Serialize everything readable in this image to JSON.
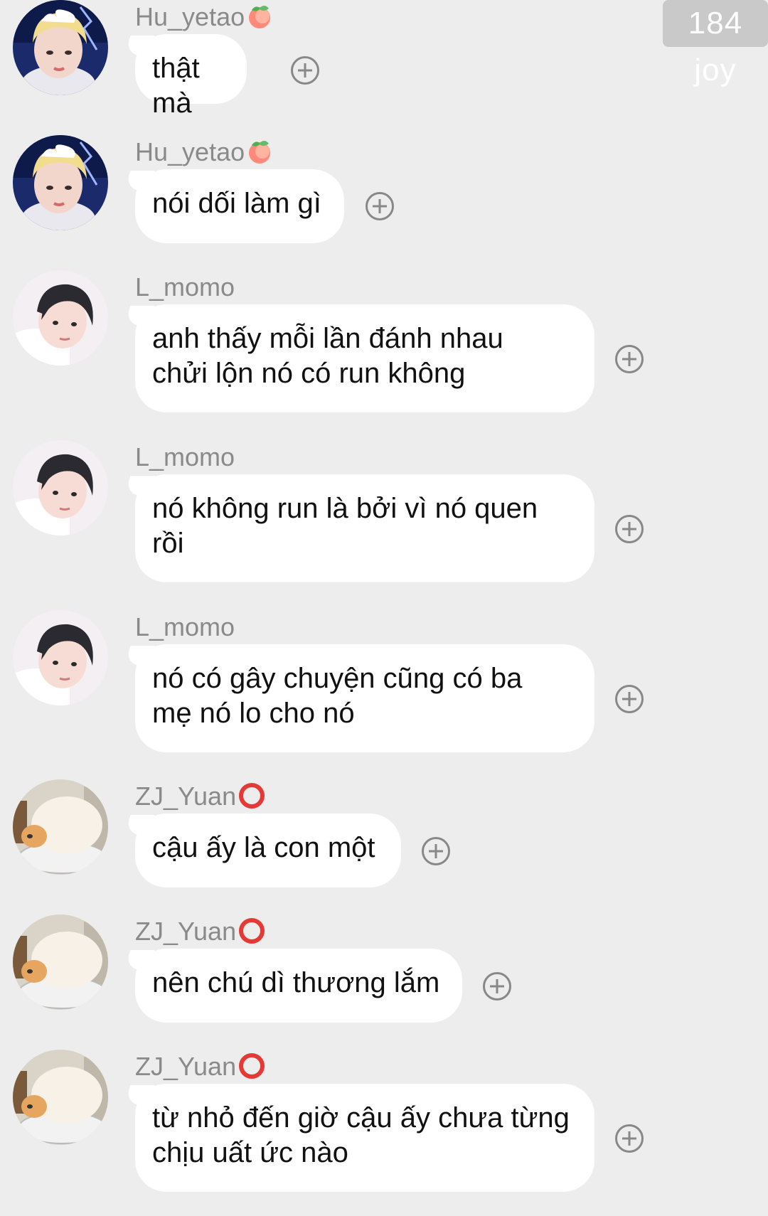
{
  "watermark": {
    "text": "184 joy"
  },
  "messages": [
    {
      "sender": "Hu_yetao",
      "sender_emoji": "peach-emoji-icon",
      "lines": [
        "thật mà"
      ],
      "avatar": "avatar-hu-yetao"
    },
    {
      "sender": "Hu_yetao",
      "sender_emoji": "peach-emoji-icon",
      "lines": [
        "nói dối làm gì"
      ],
      "avatar": "avatar-hu-yetao"
    },
    {
      "sender": "L_momo",
      "sender_emoji": "",
      "lines": [
        "anh thấy mỗi lần đánh nhau",
        "chửi lộn nó có run không"
      ],
      "avatar": "avatar-l-momo"
    },
    {
      "sender": "L_momo",
      "sender_emoji": "",
      "lines": [
        "nó không run là bởi vì nó quen",
        "rồi"
      ],
      "avatar": "avatar-l-momo"
    },
    {
      "sender": "L_momo",
      "sender_emoji": "",
      "lines": [
        "nó có gây chuyện cũng có ba",
        "mẹ nó lo cho nó"
      ],
      "avatar": "avatar-l-momo"
    },
    {
      "sender": "ZJ_Yuan",
      "sender_emoji": "red-ring-emoji-icon",
      "lines": [
        "cậu ấy là con một"
      ],
      "avatar": "avatar-zj-yuan"
    },
    {
      "sender": "ZJ_Yuan",
      "sender_emoji": "red-ring-emoji-icon",
      "lines": [
        "nên chú dì thương lắm"
      ],
      "avatar": "avatar-zj-yuan"
    },
    {
      "sender": "ZJ_Yuan",
      "sender_emoji": "red-ring-emoji-icon",
      "lines": [
        "từ nhỏ đến giờ cậu ấy chưa từng",
        "chịu uất ức nào"
      ],
      "avatar": "avatar-zj-yuan"
    }
  ],
  "colors": {
    "background": "#ededed",
    "bubble": "#ffffff",
    "name": "#8a8a8a",
    "text": "#111111"
  }
}
